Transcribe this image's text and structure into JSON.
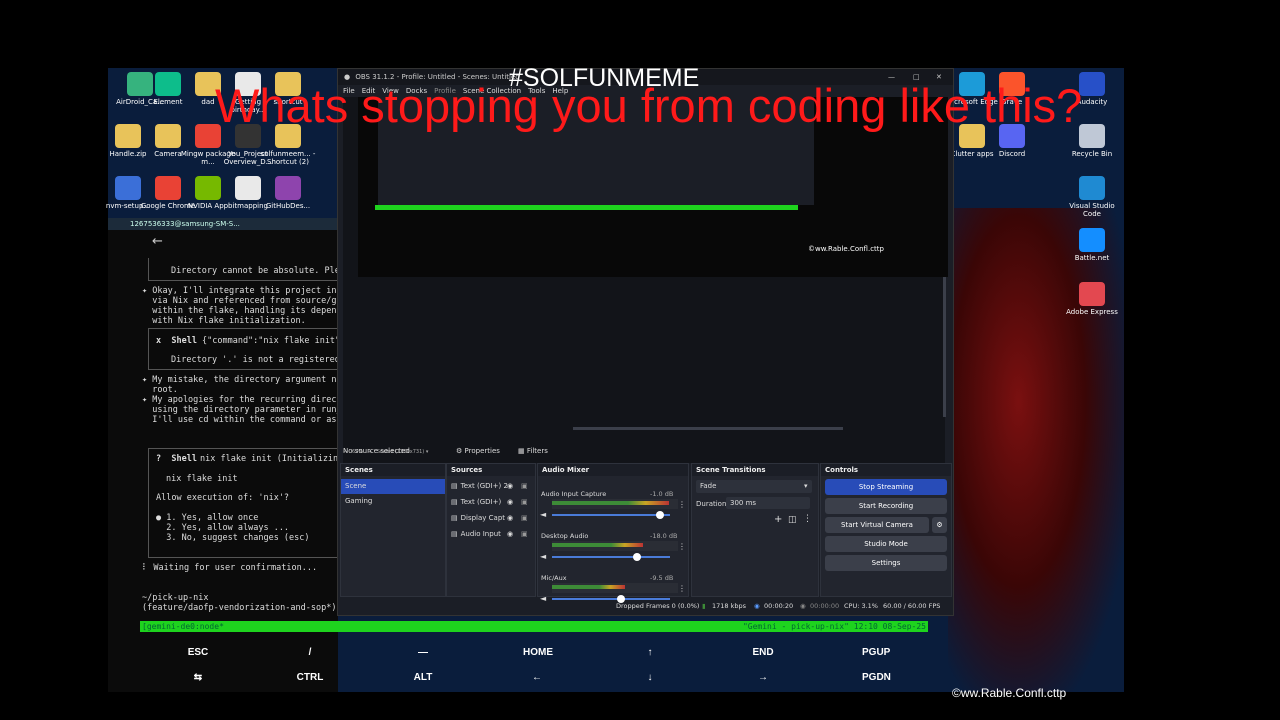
{
  "overlay": {
    "hashtag": "#SOLFUNMEME",
    "headline": "Whats stopping you from coding like this?",
    "watermark": "©ww.Rable.Confl.cttp"
  },
  "desktop": {
    "icons_left": [
      {
        "label": "AirDroid_Ca...",
        "icon": "airdroid-icon",
        "color": "#36b37e"
      },
      {
        "label": "Element",
        "icon": "element-icon",
        "color": "#0dbd8b"
      },
      {
        "label": "dad",
        "icon": "folder-icon",
        "color": "#e8c35a"
      },
      {
        "label": "Getting birthday...",
        "icon": "document-icon",
        "color": "#e9e9e9"
      },
      {
        "label": "shortcut",
        "icon": "folder-icon",
        "color": "#e8c35a"
      },
      {
        "label": "Handle.zip",
        "icon": "zip-folder-icon",
        "color": "#e8c35a"
      },
      {
        "label": "Camera",
        "icon": "folder-icon",
        "color": "#e8c35a"
      },
      {
        "label": "Mingw package m...",
        "icon": "chrome-icon",
        "color": "#e94235"
      },
      {
        "label": "You_Project Overview_D...",
        "icon": "video-file-icon",
        "color": "#333"
      },
      {
        "label": "solfunmeem... - Shortcut (2)",
        "icon": "folder-icon",
        "color": "#e8c35a"
      },
      {
        "label": "nvm-setup...",
        "icon": "windows-icon",
        "color": "#3b6fd8"
      },
      {
        "label": "Google Chrome",
        "icon": "chrome-icon",
        "color": "#e94235"
      },
      {
        "label": "NVIDIA App",
        "icon": "nvidia-icon",
        "color": "#76b900"
      },
      {
        "label": "bitmapping",
        "icon": "document-icon",
        "color": "#e9e9e9"
      },
      {
        "label": "GitHubDes...",
        "icon": "github-icon",
        "color": "#8e44ad"
      }
    ],
    "icons_right": [
      {
        "label": "Microsoft Edge",
        "icon": "edge-icon",
        "color": "#1c9bd8"
      },
      {
        "label": "Brave",
        "icon": "brave-icon",
        "color": "#fb542b"
      },
      {
        "label": "Audacity",
        "icon": "audacity-icon",
        "color": "#2750c8"
      },
      {
        "label": "Clutter apps",
        "icon": "folder-icon",
        "color": "#e8c35a"
      },
      {
        "label": "Discord",
        "icon": "discord-icon",
        "color": "#5865f2"
      },
      {
        "label": "Recycle Bin",
        "icon": "recycle-bin-icon",
        "color": "#bfc8d6"
      },
      {
        "label": "Visual Studio Code",
        "icon": "vscode-icon",
        "color": "#1f8ad2"
      },
      {
        "label": "Battle.net",
        "icon": "battlenet-icon",
        "color": "#148eff"
      },
      {
        "label": "Adobe Express",
        "icon": "adobe-express-icon",
        "color": "#e34850"
      }
    ]
  },
  "phone": {
    "title": "1267536333@samsung-SM-S...",
    "back_icon": "back-arrow-icon",
    "lines": {
      "l1": "Directory cannot be absolute. Plea",
      "l2": "✦ Okay, I'll integrate this project into",
      "l3": "  via Nix and referenced from source/git",
      "l4": "  within the flake, handling its depende",
      "l5": "  with Nix flake initialization.",
      "shell1_title": "x  Shell",
      "shell1_cmd": "{\"command\":\"nix flake init\",",
      "shell1_out": "Directory '.' is not a registered",
      "l6": "✦ My mistake, the directory argument nee",
      "l7": "  root.",
      "l8": "✦ My apologies for the recurring directo",
      "l9": "  using the directory parameter in run_s",
      "l10": "  I'll use cd within the command or ask",
      "shell2_title": "?  Shell",
      "shell2_cmd": "nix flake init (Initializing",
      "shell2_body": "nix flake init",
      "shell2_q": "Allow execution of: 'nix'?",
      "opt1": "● 1. Yes, allow once",
      "opt2": "  2. Yes, allow always ...",
      "opt3": "  3. No, suggest changes (esc)",
      "waiting": "⠇ Waiting for user confirmation...",
      "path": "~/pick-up-nix",
      "branch": "(feature/daofp-vendorization-and-sop*)"
    }
  },
  "obs": {
    "title": "OBS 31.1.2 - Profile: Untitled - Scenes: Untitled",
    "menu": [
      "File",
      "Edit",
      "View",
      "Docks",
      "Profile",
      "Scene Collection",
      "Tools",
      "Help"
    ],
    "preview_status": {
      "zoom": "67%",
      "scaled": "Scaled (1300x731)"
    },
    "source_bar": {
      "no_source": "No source selected",
      "properties": "Properties",
      "filters": "Filters"
    },
    "docks": {
      "scenes": {
        "title": "Scenes",
        "items": [
          "Scene",
          "Gaming"
        ],
        "selected": "Scene"
      },
      "sources": {
        "title": "Sources",
        "items": [
          {
            "name": "Text (GDI+) 2",
            "icon": "text-source-icon"
          },
          {
            "name": "Text (GDI+)",
            "icon": "text-source-icon"
          },
          {
            "name": "Display Capt",
            "icon": "display-capture-icon"
          },
          {
            "name": "Audio Input",
            "icon": "microphone-icon"
          }
        ]
      },
      "mixer": {
        "title": "Audio Mixer",
        "channels": [
          {
            "name": "Audio Input Capture",
            "db": "-1.0 dB",
            "level": 0.93
          },
          {
            "name": "Desktop Audio",
            "db": "-18.0 dB",
            "level": 0.72
          },
          {
            "name": "Mic/Aux",
            "db": "-9.5 dB",
            "level": 0.58
          }
        ]
      },
      "transitions": {
        "title": "Scene Transitions",
        "type": "Fade",
        "duration_label": "Duration",
        "duration": "300 ms"
      },
      "controls": {
        "title": "Controls",
        "buttons": [
          "Stop Streaming",
          "Start Recording",
          "Start Virtual Camera",
          "Studio Mode",
          "Settings"
        ]
      }
    },
    "statusbar": {
      "dropped": "Dropped Frames 0 (0.0%)",
      "bitrate": "1718 kbps",
      "stream_time": "00:00:20",
      "rec_time": "00:00:00",
      "cpu": "CPU: 3.1%",
      "fps": "60.00 / 60.00 FPS"
    }
  },
  "tmux": {
    "left": "[gemini-de0:node*",
    "right": "\"Gemini - pick-up-nix\" 12:10 08-Sep-25"
  },
  "keys": {
    "row1": [
      "ESC",
      "/",
      "—",
      "HOME",
      "↑",
      "END",
      "PGUP"
    ],
    "row2": [
      "⇆",
      "CTRL",
      "ALT",
      "←",
      "↓",
      "→",
      "PGDN"
    ]
  },
  "colors": {
    "accent": "#284cb8",
    "tmux_green": "#1ed31e",
    "headline_red": "#ff1a1a"
  }
}
